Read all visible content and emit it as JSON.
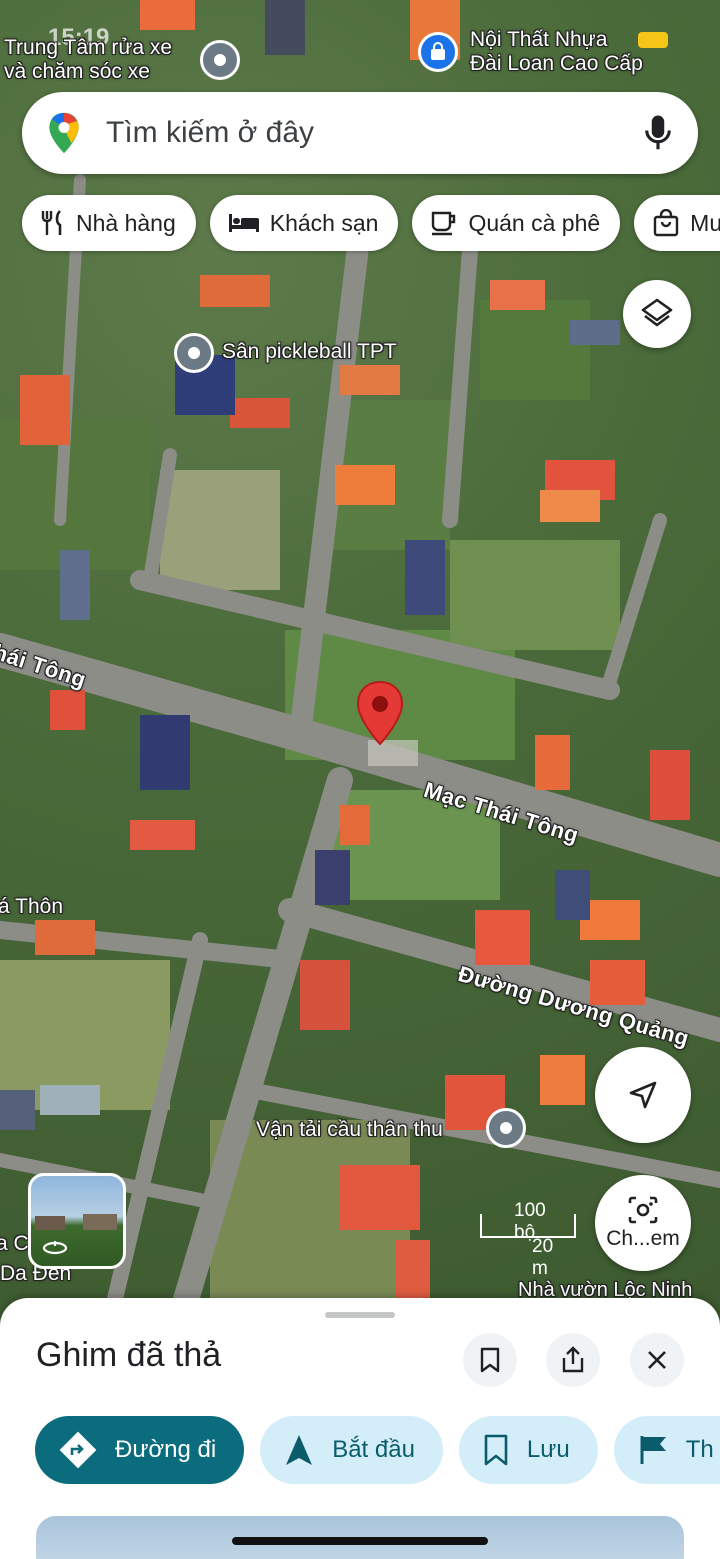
{
  "status": {
    "time": "15:19"
  },
  "search": {
    "placeholder": "Tìm kiếm ở đây"
  },
  "chips": [
    {
      "label": "Nhà hàng",
      "icon": "fork-knife-icon"
    },
    {
      "label": "Khách sạn",
      "icon": "bed-icon"
    },
    {
      "label": "Quán cà phê",
      "icon": "coffee-cup-icon"
    },
    {
      "label": "Mua sắm",
      "icon": "shopping-bag-icon"
    }
  ],
  "map": {
    "pois": [
      {
        "line1": "Trung Tâm rửa xe",
        "line2": "và chăm sóc xe"
      },
      {
        "line1": "Nội Thất Nhựa",
        "line2": "Đài Loan Cao Cấp"
      },
      {
        "line1": "Sân pickleball TPT"
      },
      {
        "line1": "Vận tải cầu thân thu"
      },
      {
        "line1": "Nhà vườn Lộc Ninh"
      }
    ],
    "roads": {
      "mac_thai_tong": "Mạc Thái Tông",
      "thai_tong_left": "hái Tông",
      "duong_duong_quang": "Đường Dương Quảng",
      "thon_left": "á Thôn",
      "bottom_left_1": "a C",
      "bottom_left_2": "Da Đen"
    },
    "scale": {
      "feet": "100 bộ",
      "meters": "20 m"
    },
    "lens_label": "Ch...em",
    "dropped_pin_color": "#e53935"
  },
  "sheet": {
    "title": "Ghim đã thả",
    "actions": [
      {
        "label": "Đường đi",
        "icon": "directions-icon"
      },
      {
        "label": "Bắt đầu",
        "icon": "navigation-arrow-icon"
      },
      {
        "label": "Lưu",
        "icon": "bookmark-icon"
      },
      {
        "label": "Th",
        "icon": "flag-icon"
      }
    ]
  }
}
